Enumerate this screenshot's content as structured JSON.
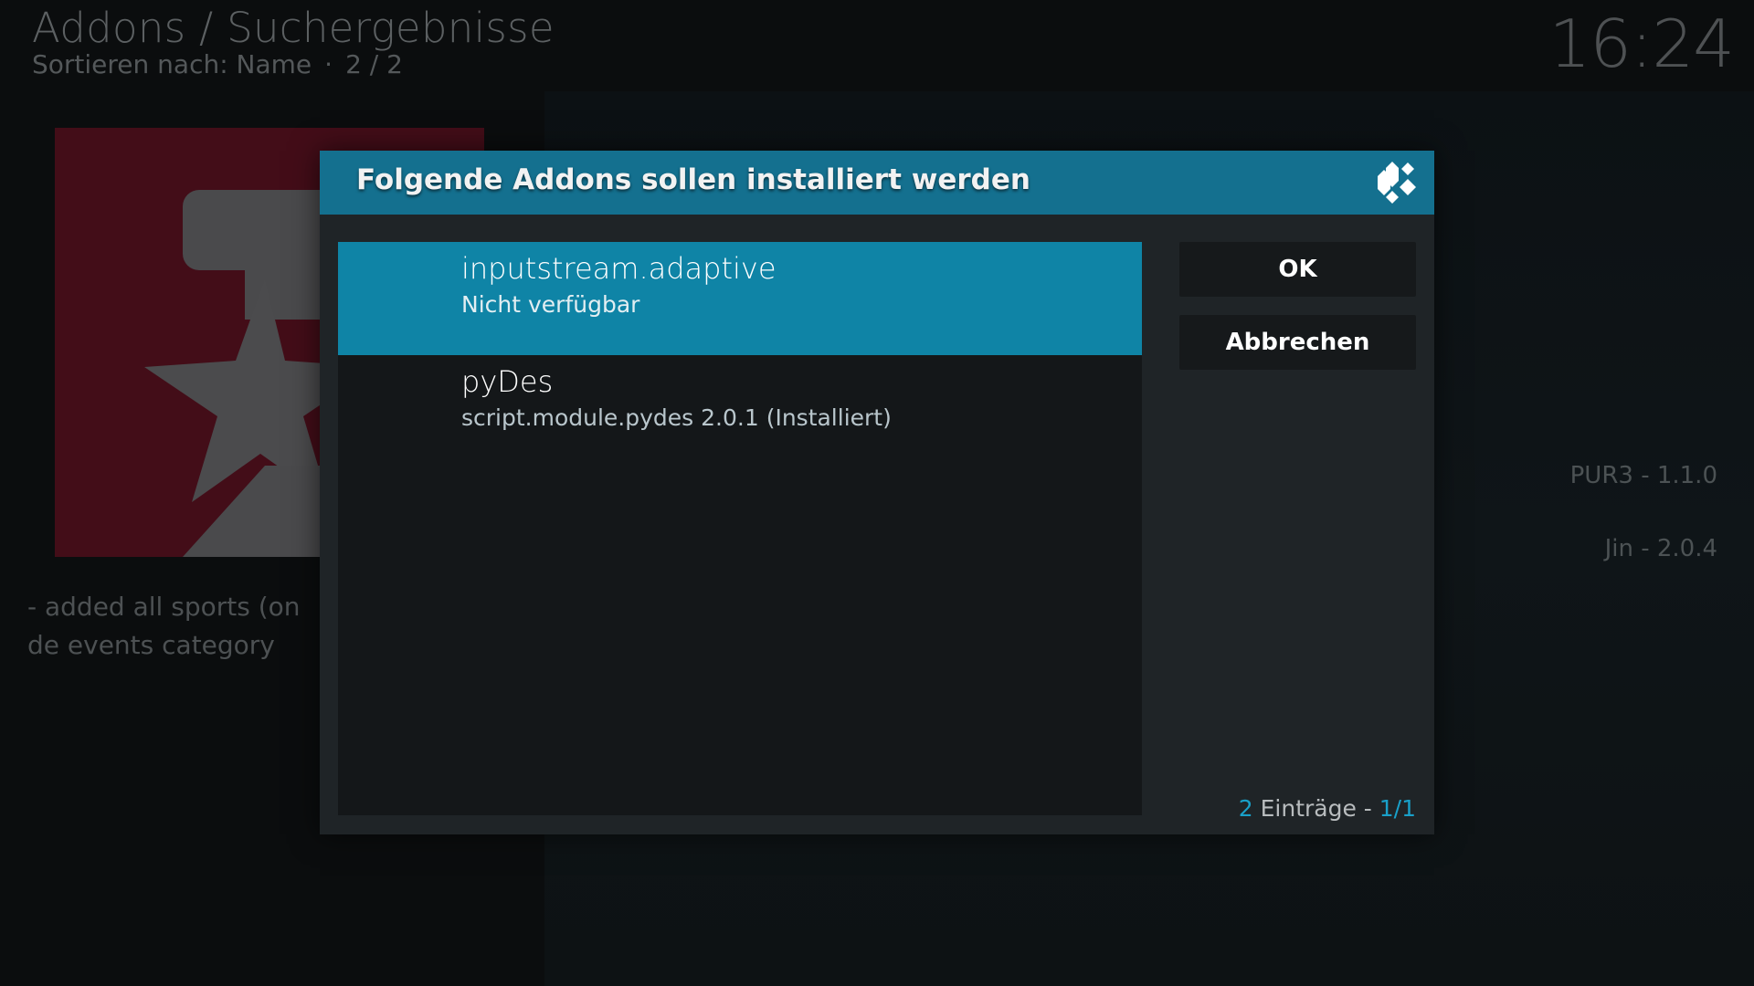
{
  "background": {
    "breadcrumb": "Addons / Suchergebnisse",
    "sort_label": "Sortieren nach: Name",
    "sort_separator": "·",
    "position": "2 / 2",
    "clock": "16:24",
    "description": "- added all sports (on de events category",
    "list_items": [
      "PUR3 - 1.1.0",
      "Jin - 2.0.4"
    ]
  },
  "dialog": {
    "title": "Folgende Addons sollen installiert werden",
    "logo_icon": "kodi-logo-icon",
    "items": [
      {
        "title": "inputstream.adaptive",
        "subtitle": "Nicht verfügbar",
        "focused": true
      },
      {
        "title": "pyDes",
        "subtitle": "script.module.pydes 2.0.1 (Installiert)",
        "focused": false
      }
    ],
    "buttons": {
      "ok": "OK",
      "cancel": "Abbrechen"
    },
    "count": {
      "total": "2",
      "label": " Einträge - ",
      "page": "1/1"
    }
  },
  "colors": {
    "header": "#14708f",
    "focus": "#0f84a6",
    "dialog_bg": "#1f2427",
    "accent": "#19a0c9"
  }
}
